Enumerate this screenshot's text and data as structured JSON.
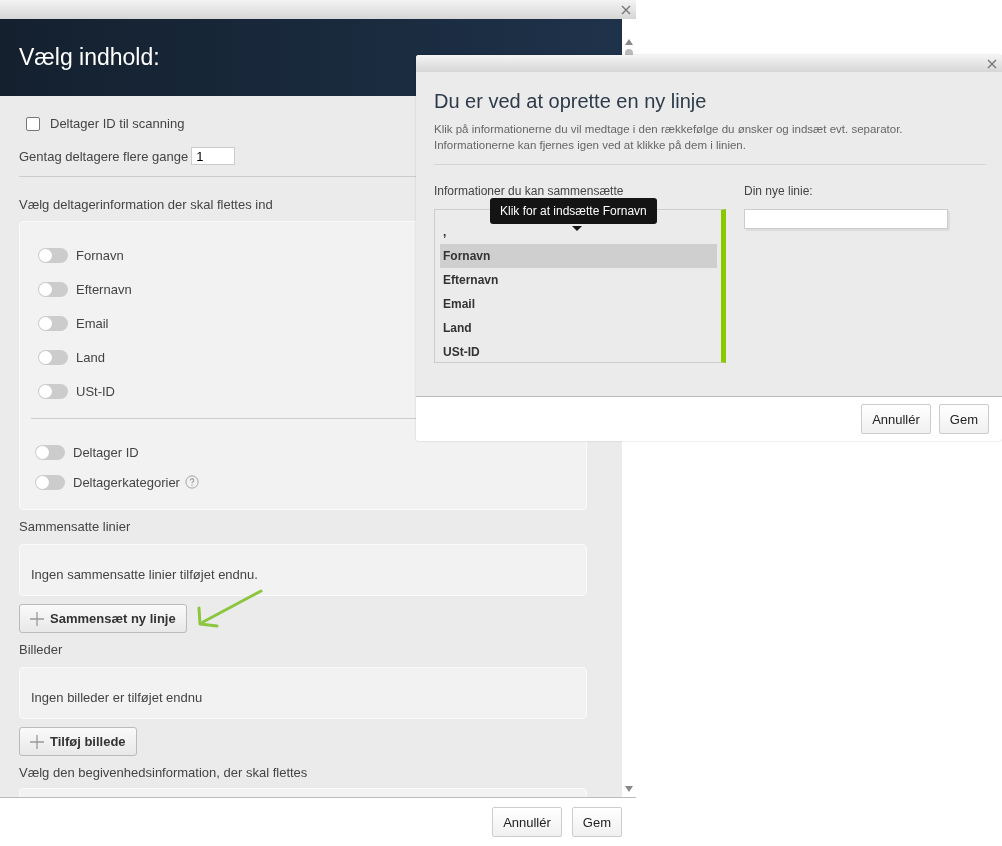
{
  "main_dialog": {
    "title": "Vælg indhold:",
    "scan_checkbox": {
      "label": "Deltager ID til scanning",
      "checked": false
    },
    "repeat": {
      "label": "Gentag deltagere flere gange",
      "value": "1"
    },
    "participant_heading": "Vælg deltagerinformation der skal flettes ind",
    "toggles": [
      {
        "label": "Fornavn",
        "on": false
      },
      {
        "label": "Efternavn",
        "on": false
      },
      {
        "label": "Email",
        "on": false
      },
      {
        "label": "Land",
        "on": false
      },
      {
        "label": "USt-ID",
        "on": false
      }
    ],
    "extra_toggles": [
      {
        "label": "Deltager ID",
        "on": false,
        "help": false
      },
      {
        "label": "Deltagerkategorier",
        "on": false,
        "help": true
      }
    ],
    "combined_heading": "Sammensatte linier",
    "combined_empty": "Ingen sammensatte linier tilføjet endnu.",
    "combined_button": "Sammensæt ny linje",
    "images_heading": "Billeder",
    "images_empty": "Ingen billeder er tilføjet endnu",
    "images_button": "Tilføj billede",
    "event_heading": "Vælg den begivenhedsinformation, der skal flettes",
    "buttons": [
      "Annullér",
      "Gem"
    ]
  },
  "line_dialog": {
    "title": "Du er ved at oprette en ny linje",
    "description": [
      "Klik på informationerne du vil medtage i den rækkefølge du ønsker og indsæt evt. separator.",
      "Informationerne kan fjernes igen ved at klikke på dem i linien."
    ],
    "available_heading": "Informationer du kan sammensætte",
    "items": [
      {
        "label": ",",
        "selected": false
      },
      {
        "label": "Fornavn",
        "selected": true
      },
      {
        "label": "Efternavn",
        "selected": false
      },
      {
        "label": "Email",
        "selected": false
      },
      {
        "label": "Land",
        "selected": false
      },
      {
        "label": "USt-ID",
        "selected": false
      }
    ],
    "tooltip": "Klik for at indsætte Fornavn",
    "new_line_label": "Din nye linie:",
    "buttons": [
      "Annullér",
      "Gem"
    ]
  }
}
